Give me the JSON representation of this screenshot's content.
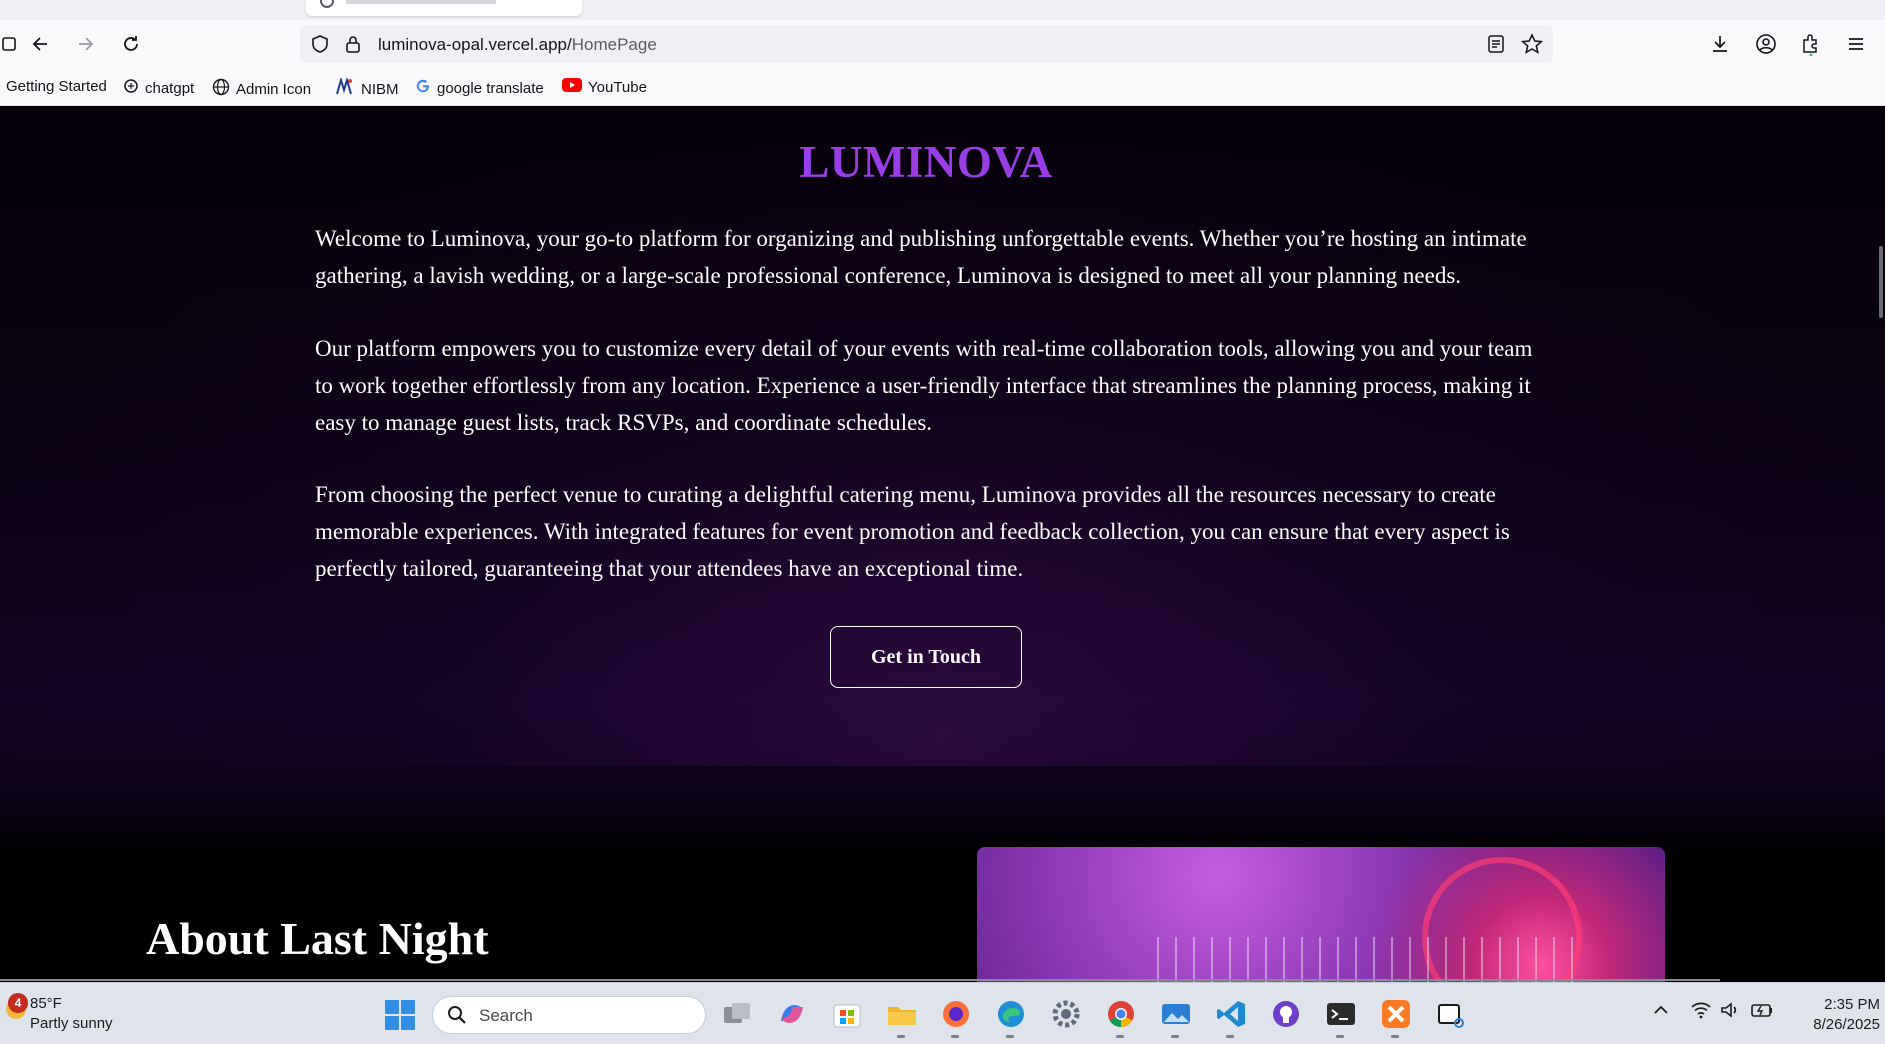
{
  "browser": {
    "url_host": "luminova-opal.vercel.app/",
    "url_path": "HomePage",
    "bookmarks": [
      {
        "label": "Getting Started",
        "icon": "firefox-icon"
      },
      {
        "label": "chatgpt",
        "icon": "chatgpt-icon"
      },
      {
        "label": "Admin Icon",
        "icon": "globe-icon"
      },
      {
        "label": "NIBM",
        "icon": "nibm-icon"
      },
      {
        "label": "google translate",
        "icon": "google-icon"
      },
      {
        "label": "YouTube",
        "icon": "youtube-icon"
      }
    ]
  },
  "page": {
    "brand": "LUMINOVA",
    "paragraphs": [
      "Welcome to Luminova, your go-to platform for organizing and publishing unforgettable events. Whether you’re hosting an intimate gathering, a lavish wedding, or a large-scale professional conference, Luminova is designed to meet all your planning needs.",
      "Our platform empowers you to customize every detail of your events with real-time collaboration tools, allowing you and your team to work together effortlessly from any location. Experience a user-friendly interface that streamlines the planning process, making it easy to manage guest lists, track RSVPs, and coordinate schedules.",
      "From choosing the perfect venue to curating a delightful catering menu, Luminova provides all the resources necessary to create memorable experiences. With integrated features for event promotion and feedback collection, you can ensure that every aspect is perfectly tailored, guaranteeing that your attendees have an exceptional time."
    ],
    "cta_label": "Get in Touch",
    "about_heading": "About Last Night"
  },
  "taskbar": {
    "weather_badge": "4",
    "temperature": "85°F",
    "condition": "Partly sunny",
    "search_placeholder": "Search",
    "time": "2:35 PM",
    "date": "8/26/2025"
  },
  "colors": {
    "brand_purple": "#9b3de6",
    "page_background": "#000000"
  }
}
